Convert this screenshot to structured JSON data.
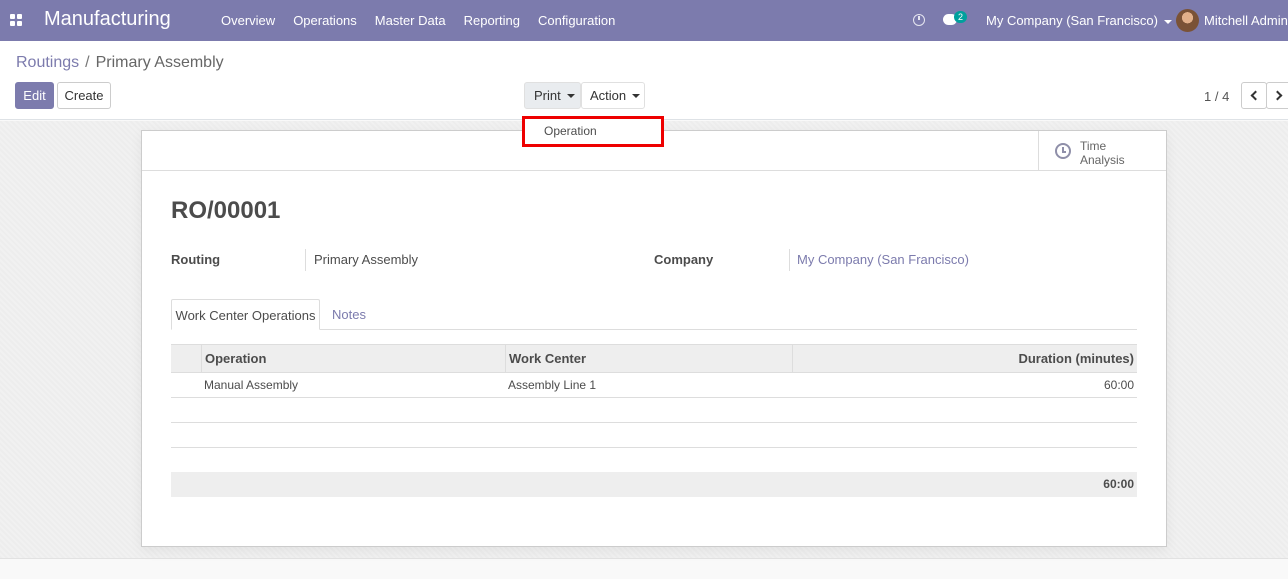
{
  "navbar": {
    "brand": "Manufacturing",
    "menu": [
      "Overview",
      "Operations",
      "Master Data",
      "Reporting",
      "Configuration"
    ],
    "chat_count": "2",
    "company": "My Company (San Francisco)",
    "user": "Mitchell Admin"
  },
  "breadcrumb": {
    "parent": "Routings",
    "separator": "/",
    "current": "Primary Assembly"
  },
  "toolbar": {
    "edit_label": "Edit",
    "create_label": "Create",
    "print_label": "Print",
    "action_label": "Action"
  },
  "print_menu": {
    "items": [
      "Operation"
    ]
  },
  "pager": {
    "value": "1 / 4"
  },
  "smart_button": {
    "line1": "Time",
    "line2": "Analysis"
  },
  "record": {
    "title": "RO/00001",
    "routing_label": "Routing",
    "routing_value": "Primary Assembly",
    "company_label": "Company",
    "company_value": "My Company (San Francisco)"
  },
  "tabs": [
    "Work Center Operations",
    "Notes"
  ],
  "table": {
    "headers": [
      "Operation",
      "Work Center",
      "Duration (minutes)"
    ],
    "rows": [
      [
        "Manual Assembly",
        "Assembly Line 1",
        "60:00"
      ]
    ],
    "total": "60:00"
  },
  "colors": {
    "brand": "#7c7bad",
    "highlight": "#e00000",
    "accent": "#00a09d"
  }
}
